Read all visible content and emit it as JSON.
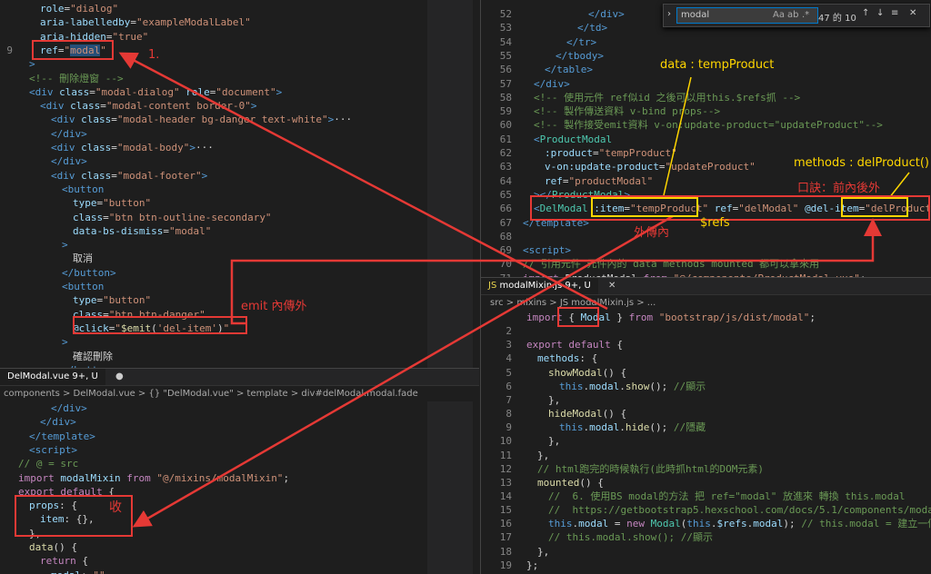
{
  "top_left": {
    "tabbar_text": "components > DelModal.vue > {} template > div#delModal.modal.fade",
    "lines": [
      {
        "n": "",
        "html": "<span class='attr'>role</span><span class='plain'>=</span><span class='str'>\"dialog\"</span>"
      },
      {
        "n": "",
        "html": "<span class='attr'>aria-labelledby</span><span class='plain'>=</span><span class='str'>\"exampleModalLabel\"</span>"
      },
      {
        "n": "",
        "html": "<span class='attr'>aria-hidden</span><span class='plain'>=</span><span class='str'>\"true\"</span>"
      },
      {
        "n": "9",
        "html": "<span class='attr'>ref</span><span class='plain'>=</span><span class='str'>\"</span><span class='str hl'>modal</span><span class='str'>\"</span>"
      },
      {
        "n": "",
        "html": "<span class='tag'>&gt;</span>"
      },
      {
        "n": "",
        "html": "<span class='cmt'>&lt;!-- 刪除燈窗 --&gt;</span>"
      },
      {
        "n": "",
        "html": "<span class='tag'>&lt;div</span> <span class='attr'>class</span><span class='plain'>=</span><span class='str'>\"modal-dialog\"</span> <span class='attr'>role</span><span class='plain'>=</span><span class='str'>\"document\"</span><span class='tag'>&gt;</span>"
      },
      {
        "n": "",
        "html": "<span class='tag'>&lt;div</span> <span class='attr'>class</span><span class='plain'>=</span><span class='str'>\"modal-content border-0\"</span><span class='tag'>&gt;</span>"
      },
      {
        "n": "",
        "html": "<span class='tag'>&lt;div</span> <span class='attr'>class</span><span class='plain'>=</span><span class='str'>\"modal-header bg-danger text-white\"</span><span class='tag'>&gt;</span><span class='plain'>···</span>"
      },
      {
        "n": "",
        "html": "<span class='tag'>&lt;/div&gt;</span>"
      },
      {
        "n": "",
        "html": "<span class='tag'>&lt;div</span> <span class='attr'>class</span><span class='plain'>=</span><span class='str'>\"modal-body\"</span><span class='tag'>&gt;</span><span class='plain'>···</span>"
      },
      {
        "n": "",
        "html": "<span class='tag'>&lt;/div&gt;</span>"
      },
      {
        "n": "",
        "html": "<span class='tag'>&lt;div</span> <span class='attr'>class</span><span class='plain'>=</span><span class='str'>\"modal-footer\"</span><span class='tag'>&gt;</span>"
      },
      {
        "n": "",
        "html": "<span class='tag'>&lt;button</span>"
      },
      {
        "n": "",
        "html": "<span class='attr'>type</span><span class='plain'>=</span><span class='str'>\"button\"</span>"
      },
      {
        "n": "",
        "html": "<span class='attr'>class</span><span class='plain'>=</span><span class='str'>\"btn btn-outline-secondary\"</span>"
      },
      {
        "n": "",
        "html": "<span class='attr'>data-bs-dismiss</span><span class='plain'>=</span><span class='str'>\"modal\"</span>"
      },
      {
        "n": "",
        "html": "<span class='tag'>&gt;</span>"
      },
      {
        "n": "",
        "html": "<span class='plain'>取消</span>"
      },
      {
        "n": "",
        "html": "<span class='tag'>&lt;/button&gt;</span>"
      },
      {
        "n": "",
        "html": "<span class='tag'>&lt;button</span>"
      },
      {
        "n": "",
        "html": "<span class='attr'>type</span><span class='plain'>=</span><span class='str'>\"button\"</span>"
      },
      {
        "n": "",
        "html": "<span class='attr'>class</span><span class='plain'>=</span><span class='str'>\"btn btn-danger\"</span>"
      },
      {
        "n": "",
        "html": "<span class='attr'>@click</span><span class='plain'>=</span><span class='str'>\"</span><span class='fn'>$emit</span><span class='plain'>(</span><span class='str'>'del-item'</span><span class='plain'>)</span><span class='str'>\"</span>"
      },
      {
        "n": "",
        "html": "<span class='tag'>&gt;</span>"
      },
      {
        "n": "",
        "html": "<span class='plain'>確認刪除</span>"
      },
      {
        "n": "",
        "html": "<span class='tag'>&lt;/button&gt;</span>"
      }
    ]
  },
  "bottom_left": {
    "tab_label": "DelModal.vue 9+, U",
    "breadcrumb": "components > DelModal.vue > {} \"DelModal.vue\" > template > div#delModal.modal.fade",
    "lines": [
      {
        "n": "",
        "html": "<span class='tag'>&lt;/div&gt;</span>"
      },
      {
        "n": "",
        "html": "<span class='tag'>&lt;/div&gt;</span>"
      },
      {
        "n": "",
        "html": "<span class='tag'>&lt;/template&gt;</span>"
      },
      {
        "n": "",
        "html": "<span class='tag'>&lt;script&gt;</span>"
      },
      {
        "n": "",
        "html": "<span class='cmt'>// @ = src</span>"
      },
      {
        "n": "",
        "html": "<span class='kw'>import</span> <span class='attr'>modalMixin</span> <span class='kw'>from</span> <span class='str'>\"@/mixins/modalMixin\"</span><span class='plain'>;</span>"
      },
      {
        "n": "",
        "html": "<span class='kw'>export</span> <span class='kw'>default</span> <span class='plain'>{</span>"
      },
      {
        "n": "",
        "html": "<span class='attr'>props</span><span class='plain'>: {</span>"
      },
      {
        "n": "",
        "html": "<span class='attr'>item</span><span class='plain'>: {},</span>"
      },
      {
        "n": "",
        "html": "<span class='plain'>},</span>"
      },
      {
        "n": "",
        "html": "<span class='fn'>data</span><span class='plain'>() {</span>"
      },
      {
        "n": "",
        "html": "<span class='kw'>return</span> <span class='plain'>{</span>"
      },
      {
        "n": "",
        "html": "<span class='attr'>modal</span><span class='plain'>: </span><span class='str'>\"\"</span><span class='plain'>,</span>"
      }
    ]
  },
  "top_right": {
    "tabbar_text": "src > views > Products.vue > {} template > ProductModal",
    "find": {
      "value": "modal",
      "count": "47 的 10",
      "case_label": "Aa",
      "word_label": "ab",
      "regex_label": ".*"
    },
    "lines": [
      {
        "n": "52",
        "html": "<span class='tag'>&lt;/div&gt;</span>"
      },
      {
        "n": "53",
        "html": "<span class='tag'>&lt;/td&gt;</span>"
      },
      {
        "n": "54",
        "html": "<span class='tag'>&lt;/tr&gt;</span>"
      },
      {
        "n": "55",
        "html": "<span class='tag'>&lt;/tbody&gt;</span>"
      },
      {
        "n": "56",
        "html": "<span class='tag'>&lt;/table&gt;</span>"
      },
      {
        "n": "57",
        "html": "<span class='tag'>&lt;/div&gt;</span>"
      },
      {
        "n": "58",
        "html": "<span class='cmt'>&lt;!-- 使用元件 ref似id 之後可以用this.$refs抓 --&gt;</span>"
      },
      {
        "n": "59",
        "html": "<span class='cmt'>&lt;!-- 製作傳送資料 v-bind props--&gt;</span>"
      },
      {
        "n": "60",
        "html": "<span class='cmt'>&lt;!-- 製作接受emit資料 v-on:update-product=\"updateProduct\"--&gt;</span>"
      },
      {
        "n": "61",
        "html": "<span class='tag'>&lt;</span><span class='comp'>ProductModal</span>"
      },
      {
        "n": "62",
        "html": "<span class='attr'>:product</span><span class='plain'>=</span><span class='str'>\"tempProduct\"</span>"
      },
      {
        "n": "63",
        "html": "<span class='attr'>v-on:update-product</span><span class='plain'>=</span><span class='str'>\"updateProduct\"</span>"
      },
      {
        "n": "64",
        "html": "<span class='attr'>ref</span><span class='plain'>=</span><span class='str'>\"productModal\"</span>"
      },
      {
        "n": "65",
        "html": "<span class='tag'>&gt;&lt;/</span><span class='comp'>ProductModal</span><span class='tag'>&gt;</span>"
      },
      {
        "n": "66",
        "html": "<span class='tag'>&lt;</span><span class='comp'>DelModal</span> <span class='attr'>:item</span><span class='plain'>=</span><span class='str'>\"tempProduct\"</span> <span class='attr'>ref</span><span class='plain'>=</span><span class='str'>\"delModal\"</span> <span class='attr'>@del-item</span><span class='plain'>=</span><span class='str'>\"delProduct\"</span> <span class='tag'>/&gt;</span>"
      },
      {
        "n": "67",
        "html": "<span class='tag'>&lt;/template&gt;</span>"
      },
      {
        "n": "68",
        "html": ""
      },
      {
        "n": "69",
        "html": "<span class='tag'>&lt;script&gt;</span>"
      },
      {
        "n": "70",
        "html": "<span class='cmt'>// 引用元件 元件內的 data methods mounted 都可以拿來用</span>"
      },
      {
        "n": "71",
        "html": "<span class='kw'>import</span> <span class='plain'>ProductModal</span> <span class='kw'>from</span> <span class='str'>\"@/components/ProductModal.vue\"</span><span class='plain'>;</span>"
      }
    ]
  },
  "bottom_right": {
    "tab_label": "modalMixin.js 9+, U",
    "breadcrumb": "src > mixins > JS modalMixin.js > ...",
    "lines": [
      {
        "n": "",
        "html": "<span class='kw'>import</span> <span class='plain'>{ </span><span class='attr'>Modal</span><span class='plain'> } </span><span class='kw'>from</span> <span class='str'>\"bootstrap/js/dist/modal\"</span><span class='plain'>;</span>"
      },
      {
        "n": "2",
        "html": ""
      },
      {
        "n": "3",
        "html": "<span class='kw'>export</span> <span class='kw'>default</span> <span class='plain'>{</span>"
      },
      {
        "n": "4",
        "html": "<span class='attr'>methods</span><span class='plain'>: {</span>"
      },
      {
        "n": "5",
        "html": "<span class='fn'>showModal</span><span class='plain'>() {</span>"
      },
      {
        "n": "6",
        "html": "<span class='tag'>this</span><span class='plain'>.</span><span class='attr'>modal</span><span class='plain'>.</span><span class='fn'>show</span><span class='plain'>(); </span><span class='cmt'>//顯示</span>"
      },
      {
        "n": "7",
        "html": "<span class='plain'>},</span>"
      },
      {
        "n": "8",
        "html": "<span class='fn'>hideModal</span><span class='plain'>() {</span>"
      },
      {
        "n": "9",
        "html": "<span class='tag'>this</span><span class='plain'>.</span><span class='attr'>modal</span><span class='plain'>.</span><span class='fn'>hide</span><span class='plain'>(); </span><span class='cmt'>//隱藏</span>"
      },
      {
        "n": "10",
        "html": "<span class='plain'>},</span>"
      },
      {
        "n": "11",
        "html": "<span class='plain'>},</span>"
      },
      {
        "n": "12",
        "html": "<span class='cmt'>// html跑完的時候執行(此時抓html的DOM元素)</span>"
      },
      {
        "n": "13",
        "html": "<span class='fn'>mounted</span><span class='plain'>() {</span>"
      },
      {
        "n": "14",
        "html": "<span class='cmt'>//  6. 使用BS modal的方法 把 ref=\"modal\" 放進來 轉換 this.modal</span>"
      },
      {
        "n": "15",
        "html": "<span class='cmt'>//  https://getbootstrap5.hexschool.com/docs/5.1/components/modal/#methods</span>"
      },
      {
        "n": "16",
        "html": "<span class='tag'>this</span><span class='plain'>.</span><span class='attr'>modal</span> <span class='plain'>= </span><span class='kw'>new</span> <span class='comp'>Modal</span><span class='plain'>(</span><span class='tag'>this</span><span class='plain'>.</span><span class='attr'>$refs</span><span class='plain'>.</span><span class='attr'>modal</span><span class='plain'>); </span><span class='cmt'>// this.modal = 建立一個Modal</span>"
      },
      {
        "n": "17",
        "html": "<span class='cmt'>// this.modal.show(); //顯示</span>"
      },
      {
        "n": "18",
        "html": "<span class='plain'>},</span>"
      },
      {
        "n": "19",
        "html": "<span class='plain'>};</span>"
      },
      {
        "n": "20",
        "html": ""
      },
      {
        "n": "21",
        "html": ""
      }
    ]
  },
  "annotations": {
    "step1": "1.",
    "emit_out": "emit 內傳外",
    "receive": "收",
    "data_label": "data : tempProduct",
    "methods_label": "methods : delProduct()",
    "mnemonic": "口訣：前內後外",
    "outer_to_inner": "外傳內",
    "refs_label": "$refs"
  },
  "colors": {
    "annotation_red": "#e53935",
    "annotation_yellow": "#ffd600",
    "editor_bg": "#1e1e1e"
  }
}
